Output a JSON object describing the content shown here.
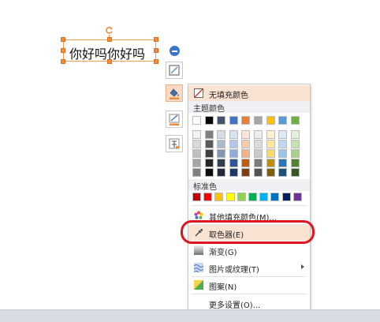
{
  "textbox": {
    "text": "你好吗你好吗"
  },
  "toolbar": {
    "buttons": [
      {
        "name": "shape-style-button",
        "icon": "shape-style-icon"
      },
      {
        "name": "fill-button",
        "icon": "paint-bucket-icon"
      },
      {
        "name": "outline-button",
        "icon": "pen-outline-icon"
      },
      {
        "name": "text-fill-button",
        "icon": "text-style-icon"
      }
    ]
  },
  "menu": {
    "no_fill": "无填充颜色",
    "theme_colors_label": "主题颜色",
    "theme_top_row": [
      "#ffffff",
      "#000000",
      "#44546a",
      "#4472c4",
      "#ed7d31",
      "#a5a5a5",
      "#ffc000",
      "#5b9bd5",
      "#70ad47"
    ],
    "theme_shades": [
      [
        "#f2f2f2",
        "#7f7f7f",
        "#d6dce4",
        "#d9e2f3",
        "#fbe5d6",
        "#ededed",
        "#fff2cc",
        "#deebf7",
        "#e2f0d9"
      ],
      [
        "#d9d9d9",
        "#595959",
        "#adb9ca",
        "#b4c7e7",
        "#f8cbad",
        "#dbdbdb",
        "#ffe699",
        "#bdd7ee",
        "#c5e0b4"
      ],
      [
        "#bfbfbf",
        "#404040",
        "#8497b0",
        "#8faadc",
        "#f4b183",
        "#c9c9c9",
        "#ffd966",
        "#9dc3e6",
        "#a9d18e"
      ],
      [
        "#a6a6a6",
        "#262626",
        "#333f50",
        "#2f5597",
        "#c55a11",
        "#7b7b7b",
        "#bf9000",
        "#2e75b6",
        "#548235"
      ],
      [
        "#808080",
        "#0d0d0d",
        "#222a35",
        "#1f3864",
        "#843c0c",
        "#525252",
        "#7f6000",
        "#1f4e79",
        "#385723"
      ]
    ],
    "standard_colors_label": "标准色",
    "standard_colors": [
      "#c00000",
      "#ff0000",
      "#ffc000",
      "#ffff00",
      "#92d050",
      "#00b050",
      "#00b0f0",
      "#0070c0",
      "#002060",
      "#7030a0"
    ],
    "other_fill": "其他填充颜色(M)...",
    "eyedropper": "取色器(E)",
    "gradient": "渐变(G)",
    "picture_texture": "图片或纹理(T)",
    "pattern": "图案(N)",
    "more_settings": "更多设置(O)..."
  },
  "colors": {
    "accent": "#f08c3c",
    "highlight": "#e0141e",
    "hover": "#fbe3d3"
  }
}
